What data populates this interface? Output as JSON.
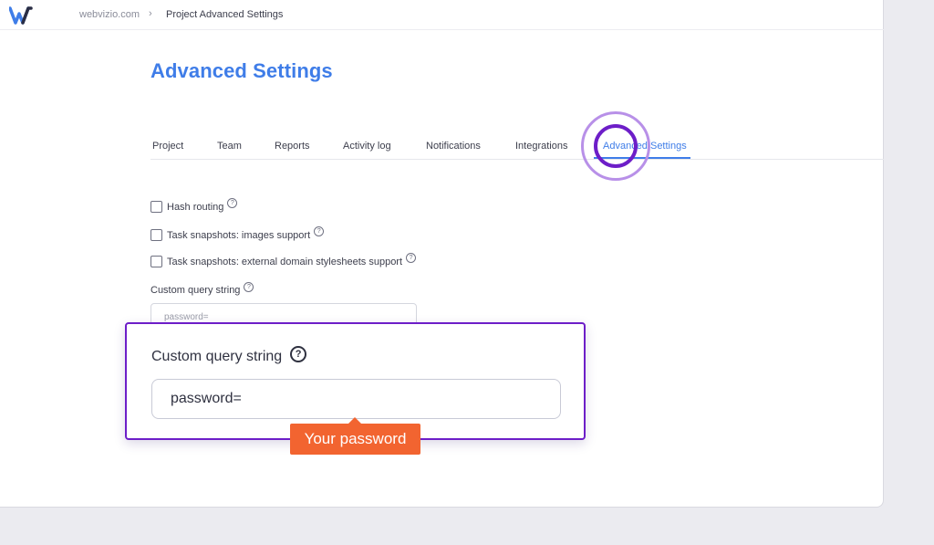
{
  "breadcrumb": {
    "root": "webvizio.com",
    "separator": "›",
    "current": "Project Advanced Settings"
  },
  "page": {
    "title": "Advanced Settings"
  },
  "tabs": [
    {
      "label": "Project"
    },
    {
      "label": "Team"
    },
    {
      "label": "Reports"
    },
    {
      "label": "Activity log"
    },
    {
      "label": "Notifications"
    },
    {
      "label": "Integrations"
    },
    {
      "label": "Advanced Settings",
      "active": true
    }
  ],
  "settings": {
    "hash_routing": {
      "label": "Hash routing",
      "checked": false,
      "help": "?"
    },
    "images_support": {
      "label": "Task snapshots: images support",
      "checked": false,
      "help": "?"
    },
    "stylesheets_support": {
      "label": "Task snapshots: external domain stylesheets support",
      "checked": false,
      "help": "?"
    },
    "custom_query": {
      "label": "Custom query string",
      "help": "?",
      "placeholder": "password="
    }
  },
  "callout": {
    "label": "Custom query string",
    "help": "?",
    "value": "password=",
    "tooltip": "Your password"
  },
  "colors": {
    "accent": "#3f7de8",
    "highlight": "#6d1ec8",
    "tooltip": "#f26430"
  },
  "icons": {
    "logo": "webvizio-logo",
    "help": "help-circle-icon",
    "checkbox": "checkbox-unchecked"
  }
}
